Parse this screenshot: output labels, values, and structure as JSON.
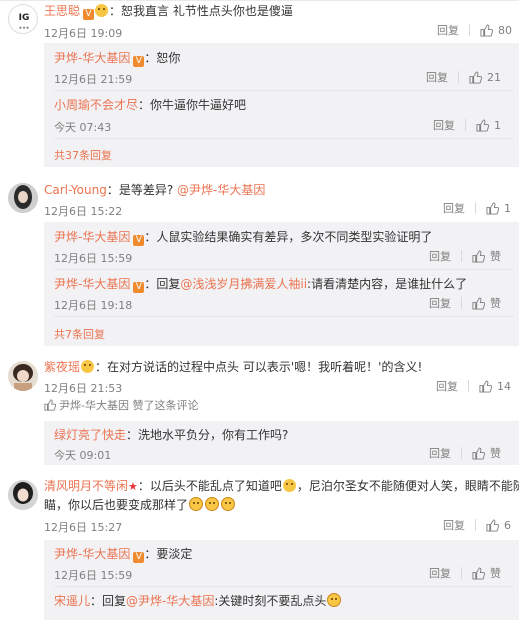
{
  "colors": {
    "accent": "#eb7350",
    "sub_bg": "#f2f2f5",
    "badge": "#f08a2f"
  },
  "c1": {
    "name": "王思聪",
    "sep": "：",
    "text": "恕我直言 礼节性点头你也是傻逼",
    "avatar_label": "IG",
    "time": "12月6日 19:09",
    "reply": "回复",
    "likes": "80",
    "replies": [
      {
        "name": "尹烨-华大基因",
        "sep": "：",
        "text": "恕你",
        "time": "12月6日 21:59",
        "reply": "回复",
        "likes": "21"
      },
      {
        "name": "小周瑜不会才尽",
        "sep": "：",
        "text": "你牛逼你牛逼好吧",
        "time": "今天 07:43",
        "reply": "回复",
        "likes": "1"
      }
    ],
    "more": "共37条回复"
  },
  "c2": {
    "name": "Carl-Young",
    "sep": "：",
    "text": "是等差异? ",
    "mention": "@尹烨-华大基因",
    "time": "12月6日 15:22",
    "reply": "回复",
    "likes": "1",
    "replies": [
      {
        "name": "尹烨-华大基因",
        "sep": "：",
        "text": "人鼠实验结果确实有差异，多次不同类型实验证明了",
        "time": "12月6日 15:59",
        "reply": "回复",
        "likes": "赞"
      },
      {
        "name": "尹烨-华大基因",
        "sep": "：",
        "pre": "回复",
        "mention": "@浅浅岁月拂满爱人袖ii",
        "text": ":请看清楚内容，是谁扯什么了",
        "time": "12月6日 19:18",
        "reply": "回复",
        "likes": "赞"
      }
    ],
    "more": "共7条回复"
  },
  "c3": {
    "name": "紫夜瑶",
    "sep": "：",
    "text": "在对方说话的过程中点头 可以表示'嗯！我听着呢！'的含义!",
    "time": "12月6日 21:53",
    "reply": "回复",
    "likes": "14",
    "liked_by": "尹烨-华大基因 赞了这条评论",
    "replies": [
      {
        "name": "绿灯亮了快走",
        "sep": "：",
        "text": "洗地水平负分，你有工作吗?",
        "time": "今天 09:01",
        "reply": "回复",
        "likes": "赞"
      }
    ]
  },
  "c4": {
    "name": "清风明月不等闲",
    "sep": "：",
    "line1": "以后头不能乱点了知道吧",
    "line1b": "，尼泊尔圣女不能随便对人笑，眼睛不能随便",
    "line2": "瞄，你以后也要变成那样了",
    "time": "12月6日 15:27",
    "reply": "回复",
    "likes": "6",
    "replies": [
      {
        "name": "尹烨-华大基因",
        "sep": "：",
        "text": "要淡定",
        "time": "12月6日 15:59",
        "reply": "回复",
        "likes": "赞"
      },
      {
        "name": "宋遥儿",
        "sep": "：",
        "pre": "回复",
        "mention": "@尹烨-华大基因",
        "text": ":关键时刻不要乱点头",
        "time": "",
        "reply": "",
        "likes": ""
      }
    ]
  }
}
